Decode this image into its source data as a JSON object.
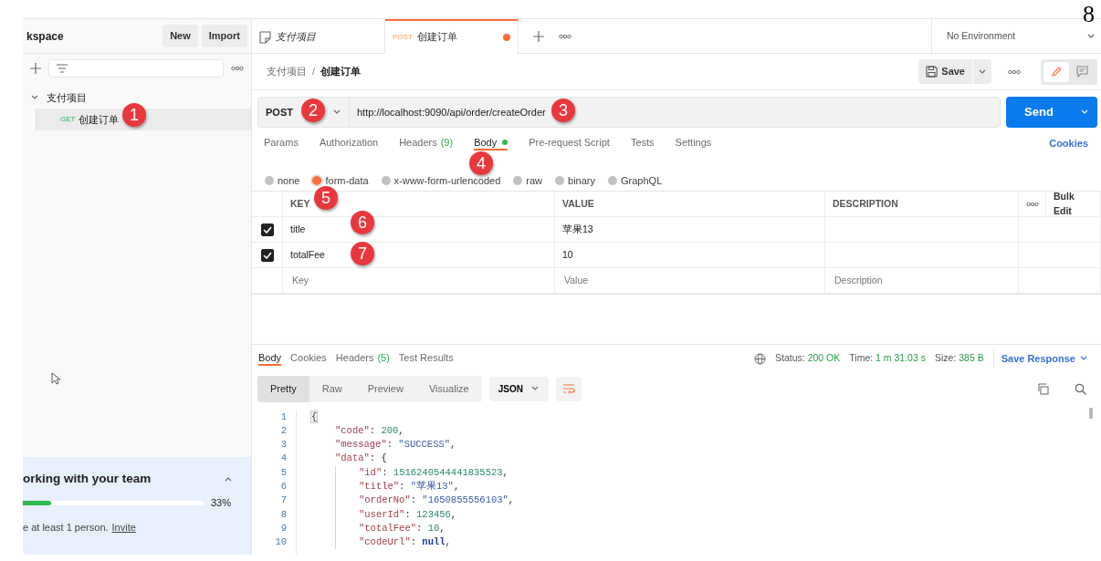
{
  "sidebar": {
    "workspace_title": "kspace",
    "buttons": [
      "New",
      "Import"
    ],
    "collections": [
      {
        "name": "支付项目",
        "expanded": true,
        "children": [
          {
            "method": "GET",
            "name": "创建订单",
            "selected": true
          }
        ]
      }
    ],
    "team_panel": {
      "title": "orking with your team",
      "expanded": true,
      "level": 0.33,
      "reading": "33%",
      "note": "e at least 1 person.",
      "link": "Invite"
    }
  },
  "tabs": [
    {
      "kind": "collection",
      "label": "支付项目",
      "selected": false,
      "unsaved": false
    },
    {
      "kind": "request",
      "method": "POST",
      "label": "创建订单",
      "selected": true,
      "unsaved": true
    }
  ],
  "environment": "No Environment",
  "breadcrumb": [
    "支付项目",
    "创建订单"
  ],
  "breadcrumb_separator": "/",
  "save_button": "Save",
  "mode_toggle": [
    {
      "kind": "edit",
      "selected": true
    },
    {
      "kind": "comments",
      "selected": false
    }
  ],
  "request": {
    "method": "POST",
    "url": "http://localhost:9090/api/order/createOrder",
    "send": "Send"
  },
  "request_tabs": [
    {
      "label": "Params",
      "selected": false,
      "indicator": false
    },
    {
      "label": "Authorization",
      "selected": false,
      "indicator": false
    },
    {
      "label": "Headers",
      "count": "(9)",
      "selected": false,
      "indicator": false
    },
    {
      "label": "Body",
      "selected": true,
      "indicator": true
    },
    {
      "label": "Pre-request Script",
      "selected": false,
      "indicator": false
    },
    {
      "label": "Tests",
      "selected": false,
      "indicator": false
    },
    {
      "label": "Settings",
      "selected": false,
      "indicator": false
    }
  ],
  "cookies_link": "Cookies",
  "body_types": [
    {
      "label": "none",
      "selected": false
    },
    {
      "label": "form-data",
      "selected": true
    },
    {
      "label": "x-www-form-urlencoded",
      "selected": false
    },
    {
      "label": "raw",
      "selected": false
    },
    {
      "label": "binary",
      "selected": false
    },
    {
      "label": "GraphQL",
      "selected": false
    }
  ],
  "params_table": {
    "columns": [
      "KEY",
      "VALUE",
      "DESCRIPTION"
    ],
    "bulk_edit": "Bulk Edit",
    "rows": [
      {
        "checked": true,
        "key": "title",
        "value": "苹果13"
      },
      {
        "checked": true,
        "key": "totalFee",
        "value": "10"
      }
    ],
    "new_row": {
      "key_placeholder": "Key",
      "value_placeholder": "Value",
      "description_placeholder": "Description"
    }
  },
  "response": {
    "tabs": [
      {
        "label": "Body",
        "selected": true
      },
      {
        "label": "Cookies",
        "selected": false
      },
      {
        "label": "Headers",
        "count": "(5)",
        "selected": false
      },
      {
        "label": "Test Results",
        "selected": false
      }
    ],
    "status": [
      {
        "label": "Status:",
        "value": "200 OK"
      },
      {
        "label": "Time:",
        "value": "1 m 31.03 s"
      },
      {
        "label": "Size:",
        "value": "385 B"
      }
    ],
    "save_response": "Save Response",
    "views": [
      {
        "label": "Pretty",
        "selected": true
      },
      {
        "label": "Raw",
        "selected": false
      },
      {
        "label": "Preview",
        "selected": false
      },
      {
        "label": "Visualize",
        "selected": false
      }
    ],
    "format": "JSON",
    "code": [
      {
        "num": "1",
        "tokens": [
          {
            "kind": "bracket",
            "text": "{"
          }
        ],
        "children": [
          {
            "num": "2",
            "tokens": [
              {
                "kind": "key",
                "text": "\"code\""
              },
              {
                "kind": "punct",
                "text": ": "
              },
              {
                "kind": "number",
                "text": "200"
              },
              {
                "kind": "punct",
                "text": ","
              }
            ]
          },
          {
            "num": "3",
            "tokens": [
              {
                "kind": "key",
                "text": "\"message\""
              },
              {
                "kind": "punct",
                "text": ": "
              },
              {
                "kind": "string",
                "text": "\"SUCCESS\""
              },
              {
                "kind": "punct",
                "text": ","
              }
            ]
          },
          {
            "num": "4",
            "tokens": [
              {
                "kind": "key",
                "text": "\"data\""
              },
              {
                "kind": "punct",
                "text": ": {"
              }
            ],
            "children": [
              {
                "num": "5",
                "tokens": [
                  {
                    "kind": "key",
                    "text": "\"id\""
                  },
                  {
                    "kind": "punct",
                    "text": ": "
                  },
                  {
                    "kind": "number",
                    "text": "1516240544441835523"
                  },
                  {
                    "kind": "punct",
                    "text": ","
                  }
                ]
              },
              {
                "num": "6",
                "tokens": [
                  {
                    "kind": "key",
                    "text": "\"title\""
                  },
                  {
                    "kind": "punct",
                    "text": ": "
                  },
                  {
                    "kind": "string",
                    "text": "\"苹果13\""
                  },
                  {
                    "kind": "punct",
                    "text": ","
                  }
                ]
              },
              {
                "num": "7",
                "tokens": [
                  {
                    "kind": "key",
                    "text": "\"orderNo\""
                  },
                  {
                    "kind": "punct",
                    "text": ": "
                  },
                  {
                    "kind": "string",
                    "text": "\"1650855556103\""
                  },
                  {
                    "kind": "punct",
                    "text": ","
                  }
                ]
              },
              {
                "num": "8",
                "tokens": [
                  {
                    "kind": "key",
                    "text": "\"userId\""
                  },
                  {
                    "kind": "punct",
                    "text": ": "
                  },
                  {
                    "kind": "number",
                    "text": "123456"
                  },
                  {
                    "kind": "punct",
                    "text": ","
                  }
                ]
              },
              {
                "num": "9",
                "tokens": [
                  {
                    "kind": "key",
                    "text": "\"totalFee\""
                  },
                  {
                    "kind": "punct",
                    "text": ": "
                  },
                  {
                    "kind": "number",
                    "text": "10"
                  },
                  {
                    "kind": "punct",
                    "text": ","
                  }
                ]
              },
              {
                "num": "10",
                "tokens": [
                  {
                    "kind": "key",
                    "text": "\"codeUrl\""
                  },
                  {
                    "kind": "punct",
                    "text": ": "
                  },
                  {
                    "kind": "null",
                    "text": "null"
                  },
                  {
                    "kind": "punct",
                    "text": ","
                  }
                ]
              }
            ]
          }
        ]
      }
    ]
  },
  "annotations": [
    {
      "kind": "badge",
      "label": "1"
    },
    {
      "kind": "badge",
      "label": "2"
    },
    {
      "kind": "badge",
      "label": "3"
    },
    {
      "kind": "badge",
      "label": "4"
    },
    {
      "kind": "badge",
      "label": "5"
    },
    {
      "kind": "badge",
      "label": "6"
    },
    {
      "kind": "badge",
      "label": "7"
    },
    {
      "kind": "plain",
      "label": "8"
    }
  ]
}
